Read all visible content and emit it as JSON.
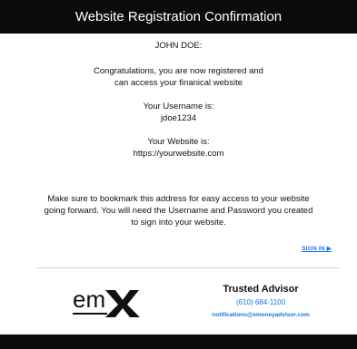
{
  "header": {
    "title": "Website Registration Confirmation"
  },
  "body": {
    "greeting": "JOHN DOE:",
    "congrats_line1": "Congratulations, you are now registered and",
    "congrats_line2": "can access your finanical website",
    "username_label": "Your Username is:",
    "username_value": "jdoe1234",
    "website_label": "Your Website is:",
    "website_value": "https://yourwebsite.com",
    "notice_line1": "Make sure to bookmark this address for easy access to your website",
    "notice_line2": "going forward. You will need the Username and Password you created",
    "notice_line3": "to sign into your website."
  },
  "signin": {
    "label": "SIGN IN ▶"
  },
  "footer": {
    "logo_text": "emX",
    "advisor_name": "Trusted Advisor",
    "advisor_phone": "(610) 684-1100",
    "advisor_email": "notifications@emoneyadvisor.com"
  },
  "colors": {
    "header_bg": "#0b0b0b",
    "link": "#1a73e8"
  }
}
